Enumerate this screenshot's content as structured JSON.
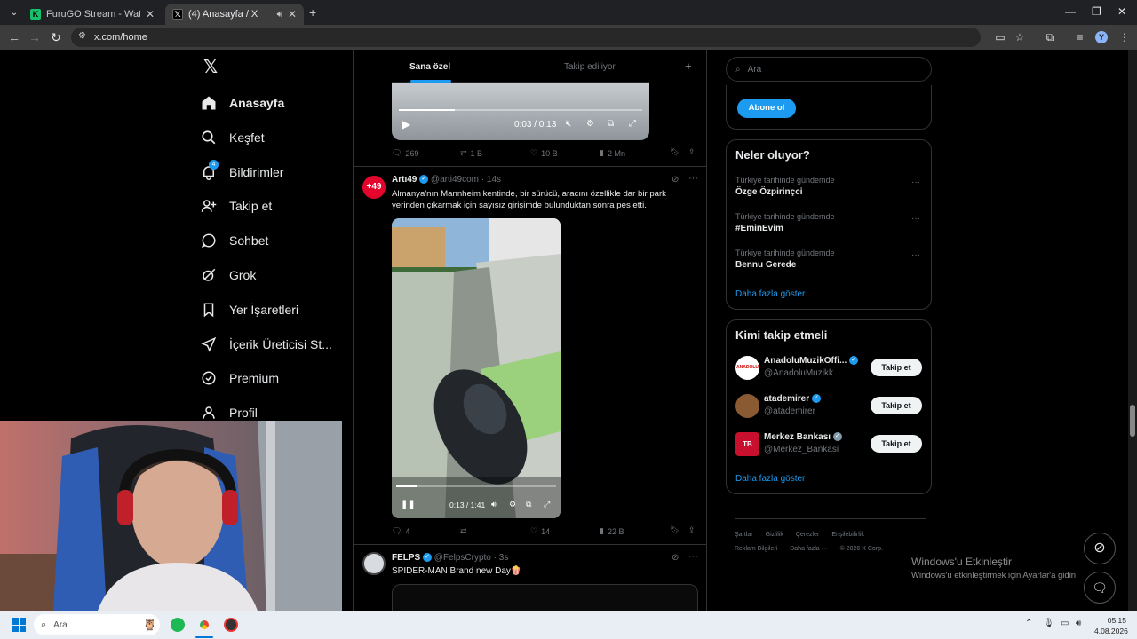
{
  "browser": {
    "tabs": [
      {
        "title": "FuruGO Stream - Watch Live o",
        "active": false
      },
      {
        "title": "(4) Anasayfa / X",
        "active": true
      }
    ],
    "url": "x.com/home"
  },
  "sidebar": {
    "items": [
      {
        "label": "Anasayfa",
        "icon": "home-icon"
      },
      {
        "label": "Keşfet",
        "icon": "search-icon"
      },
      {
        "label": "Bildirimler",
        "icon": "bell-icon",
        "badge": "4"
      },
      {
        "label": "Takip et",
        "icon": "person-add-icon"
      },
      {
        "label": "Sohbet",
        "icon": "chat-icon"
      },
      {
        "label": "Grok",
        "icon": "grok-icon"
      },
      {
        "label": "Yer İşaretleri",
        "icon": "bookmark-icon"
      },
      {
        "label": "İçerik Üreticisi St...",
        "icon": "rocket-icon"
      },
      {
        "label": "Premium",
        "icon": "verified-icon"
      },
      {
        "label": "Profil",
        "icon": "person-icon"
      }
    ]
  },
  "timeline": {
    "tabs": [
      "Sana özel",
      "Takip ediliyor"
    ],
    "prev_post": {
      "video_time": "0:03 / 0:13",
      "replies": "269",
      "reposts": "1 B",
      "likes": "10 B",
      "views": "2 Mn"
    },
    "post1": {
      "author": "Artı49",
      "handle": "@arti49com",
      "time": "14s",
      "avatar_text": "+49",
      "text": "Almanya'nın Mannheim kentinde, bir sürücü, aracını özellikle dar bir park yerinden çıkarmak için sayısız girişimde bulunduktan sonra pes etti.",
      "video_time": "0:13 / 1:41",
      "video_progress": 0.13,
      "replies": "4",
      "reposts": "",
      "likes": "14",
      "views": "22 B"
    },
    "post2": {
      "author": "FELPS",
      "handle": "@FelpsCrypto",
      "time": "3s",
      "text": "SPIDER-MAN Brand new Day🍿"
    }
  },
  "right": {
    "search_placeholder": "Ara",
    "subscribe_label": "Abone ol",
    "trends_title": "Neler oluyor?",
    "trends": [
      {
        "meta": "Türkiye tarihinde gündemde",
        "title": "Özge Özpirinçci"
      },
      {
        "meta": "Türkiye tarihinde gündemde",
        "title": "#EminEvim"
      },
      {
        "meta": "Türkiye tarihinde gündemde",
        "title": "Bennu Gerede"
      }
    ],
    "show_more": "Daha fazla göster",
    "who_title": "Kimi takip etmeli",
    "who": [
      {
        "name": "AnadoluMuzikOffi...",
        "handle": "@AnadoluMuzikk"
      },
      {
        "name": "atademirer",
        "handle": "@atademirer"
      },
      {
        "name": "Merkez Bankası",
        "handle": "@Merkez_Bankasi"
      }
    ],
    "follow_label": "Takip et",
    "footer_line1": [
      "Şartlar",
      "Gizlilik",
      "Çerezler",
      "Erişilebilirlik"
    ],
    "footer_line2": [
      "Reklam Bilgileri",
      "Daha fazla ···",
      "© 2026 X Corp."
    ]
  },
  "watermark": {
    "title": "Windows'u Etkinleştir",
    "subtitle": "Windows'u etkinleştirmek için Ayarlar'a gidin."
  },
  "taskbar": {
    "search_placeholder": "Ara",
    "time": "05:15",
    "date": "4.08.2026"
  },
  "colors": {
    "accent": "#1d9bf0",
    "background": "#000000",
    "border": "#2f3336"
  }
}
